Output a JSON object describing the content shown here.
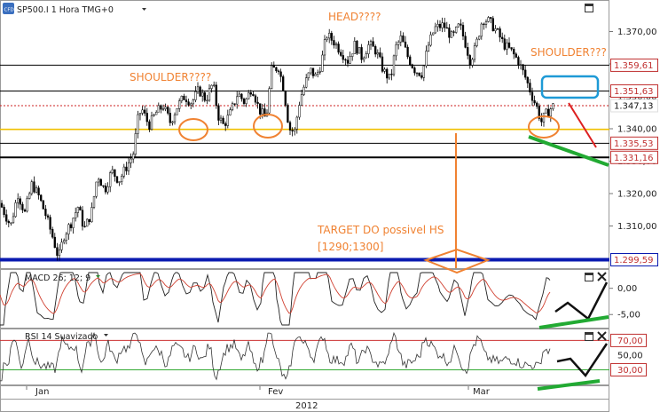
{
  "header": {
    "symbol_label": "SP500.I 1 Hora TMG+0",
    "logo_text": "CFD",
    "dropdown_icon": "chevron-down-icon"
  },
  "chart_data": {
    "type": "candlestick",
    "title": "SP500.I 1 Hora TMG+0",
    "y_ticks": [
      "1.370,00",
      "1.360,00",
      "1.350,00",
      "1.340,00",
      "1.330,00",
      "1.320,00",
      "1.310,00"
    ],
    "ylim": [
      1296.5,
      1376.5
    ],
    "x_ticks": [
      "Jan",
      "Fev",
      "Mar"
    ],
    "x_caption": "2012",
    "close_points": [
      [
        0,
        1317
      ],
      [
        12,
        1310
      ],
      [
        20,
        1320
      ],
      [
        28,
        1314
      ],
      [
        36,
        1323
      ],
      [
        44,
        1319
      ],
      [
        52,
        1313
      ],
      [
        60,
        1306
      ],
      [
        66,
        1300
      ],
      [
        72,
        1307
      ],
      [
        80,
        1311
      ],
      [
        88,
        1316
      ],
      [
        95,
        1309
      ],
      [
        103,
        1314
      ],
      [
        110,
        1326
      ],
      [
        118,
        1321
      ],
      [
        126,
        1327
      ],
      [
        134,
        1324
      ],
      [
        142,
        1328
      ],
      [
        150,
        1332
      ],
      [
        156,
        1344
      ],
      [
        160,
        1346
      ],
      [
        168,
        1341
      ],
      [
        176,
        1345
      ],
      [
        184,
        1347
      ],
      [
        192,
        1342
      ],
      [
        200,
        1347
      ],
      [
        208,
        1350
      ],
      [
        216,
        1348
      ],
      [
        224,
        1352
      ],
      [
        232,
        1349
      ],
      [
        240,
        1354
      ],
      [
        246,
        1344
      ],
      [
        252,
        1341
      ],
      [
        260,
        1345
      ],
      [
        268,
        1351
      ],
      [
        276,
        1348
      ],
      [
        284,
        1353
      ],
      [
        292,
        1346
      ],
      [
        300,
        1343
      ],
      [
        306,
        1358
      ],
      [
        314,
        1359
      ],
      [
        320,
        1352
      ],
      [
        326,
        1340
      ],
      [
        332,
        1339
      ],
      [
        338,
        1349
      ],
      [
        344,
        1354
      ],
      [
        350,
        1358
      ],
      [
        356,
        1356
      ],
      [
        362,
        1360
      ],
      [
        368,
        1369
      ],
      [
        376,
        1367
      ],
      [
        384,
        1364
      ],
      [
        392,
        1361
      ],
      [
        400,
        1366
      ],
      [
        408,
        1362
      ],
      [
        416,
        1366
      ],
      [
        424,
        1364
      ],
      [
        432,
        1358
      ],
      [
        440,
        1355
      ],
      [
        446,
        1365
      ],
      [
        452,
        1368
      ],
      [
        460,
        1362
      ],
      [
        468,
        1358
      ],
      [
        476,
        1357
      ],
      [
        482,
        1365
      ],
      [
        490,
        1371
      ],
      [
        500,
        1372
      ],
      [
        510,
        1368
      ],
      [
        518,
        1372
      ],
      [
        524,
        1367
      ],
      [
        530,
        1361
      ],
      [
        536,
        1365
      ],
      [
        544,
        1374
      ],
      [
        552,
        1373
      ],
      [
        560,
        1370
      ],
      [
        568,
        1366
      ],
      [
        576,
        1364
      ],
      [
        584,
        1361
      ],
      [
        592,
        1356
      ],
      [
        600,
        1350
      ],
      [
        606,
        1346
      ],
      [
        610,
        1342
      ],
      [
        614,
        1344
      ],
      [
        620,
        1346
      ],
      [
        624,
        1347.13
      ]
    ],
    "price_labels": [
      {
        "value": 1359.61,
        "text": "1.359,61",
        "style": "red-box"
      },
      {
        "value": 1351.63,
        "text": "1.351,63",
        "style": "red-box"
      },
      {
        "value": 1347.13,
        "text": "1.347,13",
        "style": "last-price"
      },
      {
        "value": 1335.53,
        "text": "1.335,53",
        "style": "red-box"
      },
      {
        "value": 1331.16,
        "text": "1.331,16",
        "style": "red-box"
      },
      {
        "value": 1299.59,
        "text": "1.299,59",
        "style": "blue-box"
      }
    ],
    "horizontal_lines": [
      {
        "value": 1359.61,
        "color": "#000000",
        "style": "solid"
      },
      {
        "value": 1351.63,
        "color": "#000000",
        "style": "solid"
      },
      {
        "value": 1347.13,
        "color": "#cc2020",
        "style": "dotted"
      },
      {
        "value": 1339.8,
        "color": "#f0c000",
        "style": "solid"
      },
      {
        "value": 1335.53,
        "color": "#000000",
        "style": "solid"
      },
      {
        "value": 1331.16,
        "color": "#000000",
        "style": "solid-thick"
      },
      {
        "value": 1299.59,
        "color": "#0a1ab0",
        "style": "solid-thick"
      }
    ],
    "annotations": [
      {
        "text": "HEAD????"
      },
      {
        "text": "SHOULDER????"
      },
      {
        "text": "SHOULDER???"
      },
      {
        "text": "TARGET DO possivel HS"
      },
      {
        "text": "[1290;1300]"
      }
    ],
    "macd": {
      "label": "MACD 26; 12; 9",
      "y_ticks": [
        "0,00",
        "-5,00"
      ],
      "ylim": [
        -7.5,
        3.5
      ]
    },
    "rsi": {
      "label": "RSI 14 Suavizado",
      "y_ticks": [
        "70,00",
        "50,00",
        "30,00"
      ],
      "levels": [
        70,
        30
      ],
      "ylim": [
        10,
        85
      ]
    },
    "grid": false,
    "legend": "none"
  },
  "colors": {
    "candle_up": "#ffffff",
    "candle_down": "#000000",
    "annotation": "#f08232",
    "support": "#f0c000",
    "target_line": "#0a1ab0",
    "trend_green": "#22aa33",
    "macd_signal": "#d04030",
    "rsi_levels": "#33aa33",
    "box_blue": "#1e9ad6",
    "arrow_red": "#dd2020"
  }
}
